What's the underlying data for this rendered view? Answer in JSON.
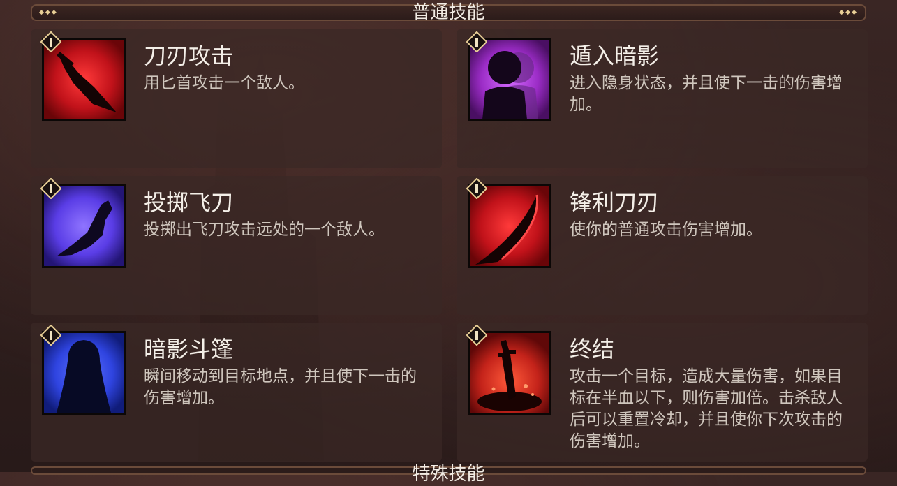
{
  "section": {
    "title": "普通技能",
    "next_title": "特殊技能"
  },
  "colors": {
    "gold_accent": "#e8cf96",
    "card_bg": "#3a2826",
    "title_text": "#f4efe8",
    "desc_text": "#cfc6bd"
  },
  "skills": [
    {
      "name": "刀刃攻击",
      "description": "用匕首攻击一个敌人。",
      "icon": "dagger-icon",
      "icon_color": "#c1121a"
    },
    {
      "name": "遁入暗影",
      "description": "进入隐身状态，并且使下一击的伤害增加。",
      "icon": "shadow-figure-icon",
      "icon_color": "#9b2cc6"
    },
    {
      "name": "投掷飞刀",
      "description": "投掷出飞刀攻击远处的一个敌人。",
      "icon": "throwing-knife-icon",
      "icon_color": "#5a3de6"
    },
    {
      "name": "锋利刀刃",
      "description": "使你的普通攻击伤害增加。",
      "icon": "sharp-blade-icon",
      "icon_color": "#c1121a"
    },
    {
      "name": "暗影斗篷",
      "description": "瞬间移动到目标地点，并且使下一击的伤害增加。",
      "icon": "hooded-cloak-icon",
      "icon_color": "#2f44e0"
    },
    {
      "name": "终结",
      "description": "攻击一个目标，造成大量伤害，如果目标在半血以下，则伤害加倍。击杀敌人后可以重置冷却，并且使你下次攻击的伤害增加。",
      "icon": "execute-stab-icon",
      "icon_color": "#c4231a"
    }
  ]
}
